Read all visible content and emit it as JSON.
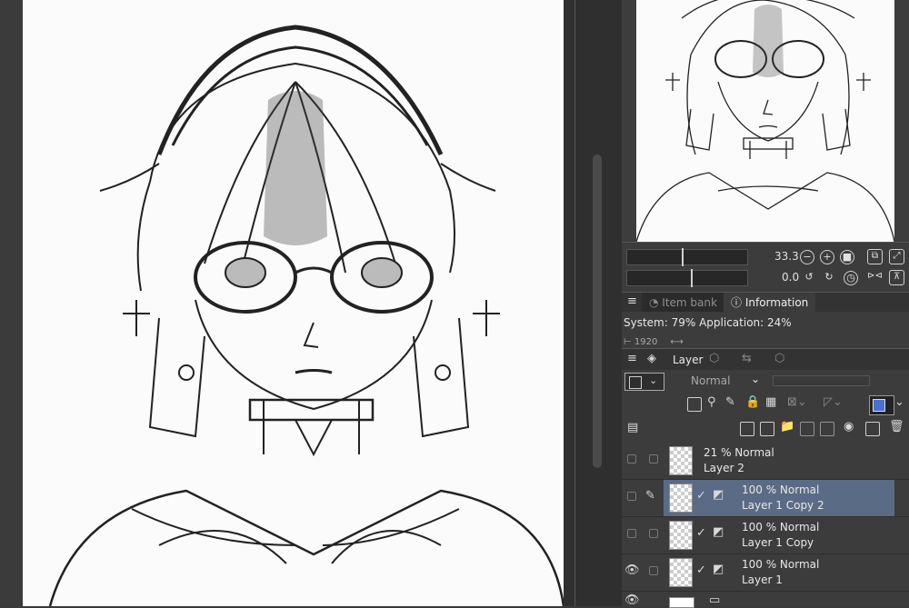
{
  "navigator": {
    "zoom_value": "33.3",
    "rotation_value": "0.0"
  },
  "panel_tabs": {
    "item_bank": "Item bank",
    "information": "Information"
  },
  "information": {
    "system_usage": "System: 79% Application: 24%",
    "partial_readout": "1920"
  },
  "layer_panel": {
    "tab_label": "Layer",
    "blend_mode": "Normal",
    "layers": [
      {
        "opacity_mode": "21 % Normal",
        "name": "Layer 2",
        "visible": false,
        "selected": false
      },
      {
        "opacity_mode": "100 % Normal",
        "name": "Layer 1 Copy 2",
        "visible": false,
        "selected": true
      },
      {
        "opacity_mode": "100 % Normal",
        "name": "Layer 1 Copy",
        "visible": false,
        "selected": false
      },
      {
        "opacity_mode": "100 % Normal",
        "name": "Layer 1",
        "visible": true,
        "selected": false
      }
    ]
  },
  "colors": {
    "panel_bg": "#3c3c3c",
    "selected_layer": "#5a6b86",
    "canvas": "#fbfbfb"
  }
}
